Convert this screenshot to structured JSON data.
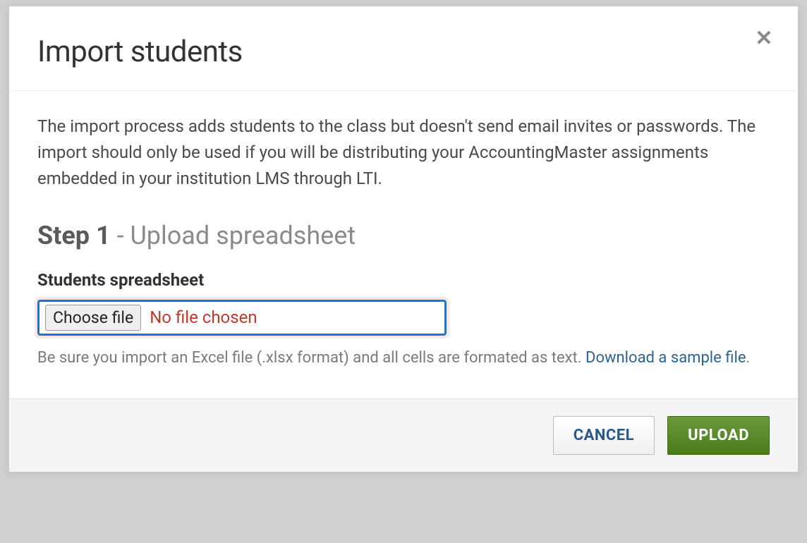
{
  "modal": {
    "title": "Import students",
    "description": "The import process adds students to the class but doesn't send email invites or passwords. The import should only be used if you will be distributing your AccountingMaster assignments embedded in your institution LMS through LTI.",
    "step": {
      "number": "Step 1",
      "separator": " - ",
      "title": "Upload spreadsheet"
    },
    "fieldLabel": "Students spreadsheet",
    "fileInput": {
      "buttonLabel": "Choose file",
      "status": "No file chosen"
    },
    "helperText": {
      "prefix": "Be sure you import an Excel file (.xlsx format) and all cells are formated as text. ",
      "linkText": "Download a sample file",
      "suffix": "."
    },
    "buttons": {
      "cancel": "CANCEL",
      "upload": "UPLOAD"
    }
  }
}
